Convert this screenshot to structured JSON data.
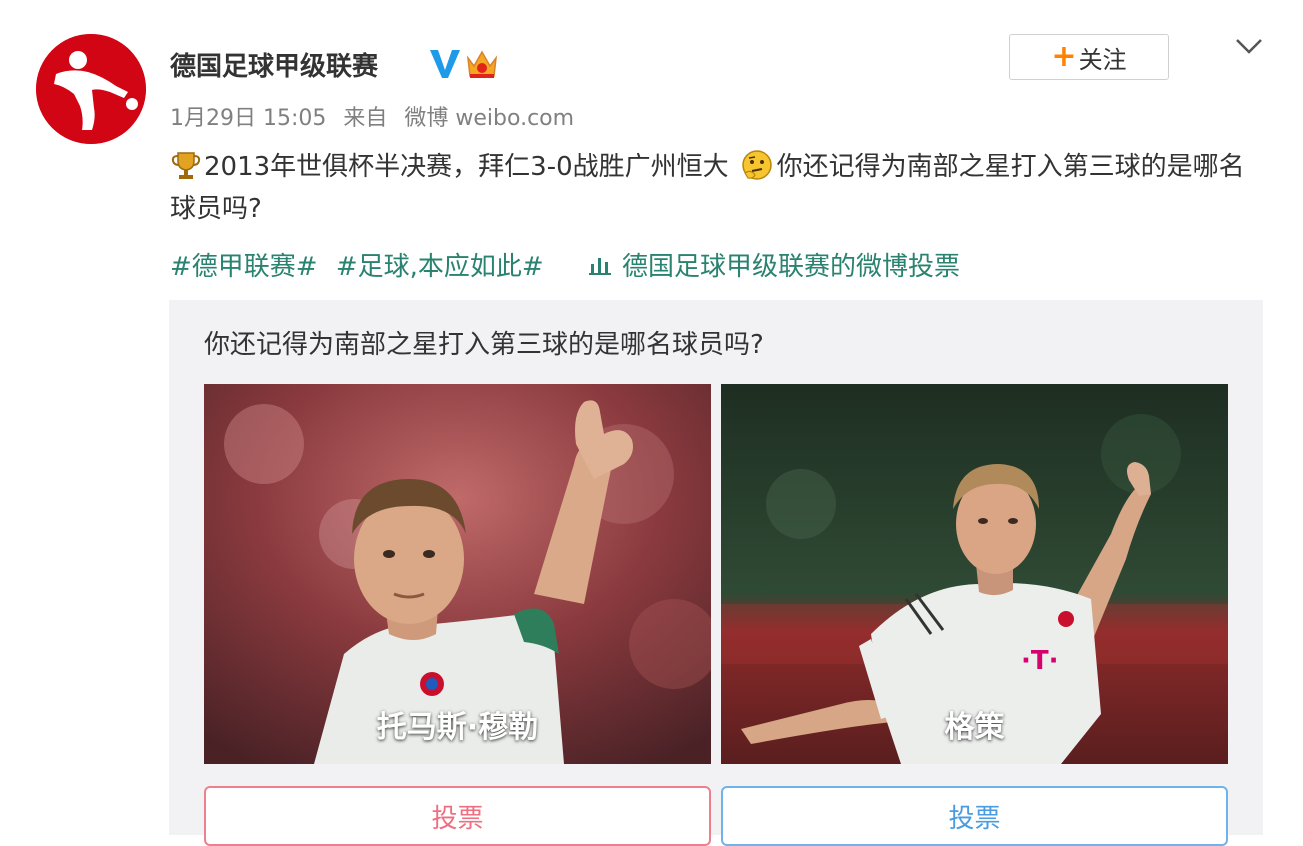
{
  "post": {
    "author": "德国足球甲级联赛",
    "verified_icon": "blue-v-icon",
    "member_icon": "crown-icon",
    "follow_label": "关注",
    "date": "1月29日 15:05",
    "source_prefix": "来自",
    "source": "微博 weibo.com",
    "text_part1": "2013年世俱杯半决赛，拜仁3-0战胜广州恒大",
    "text_part2": "你还记得为南部之星打入第三球的是哪名球员吗?",
    "tags": [
      "#德甲联赛#",
      "#足球,本应如此#"
    ],
    "vote_link": "德国足球甲级联赛的微博投票"
  },
  "poll": {
    "question": "你还记得为南部之星打入第三球的是哪名球员吗?",
    "options": [
      {
        "label": "托马斯·穆勒",
        "button": "投票"
      },
      {
        "label": "格策",
        "button": "投票"
      }
    ]
  },
  "colors": {
    "brand_red": "#d20515",
    "tag_green": "#2a8370",
    "follow_orange": "#ff8200",
    "vote_left": "#ef6f82",
    "vote_right": "#4a9be0"
  }
}
